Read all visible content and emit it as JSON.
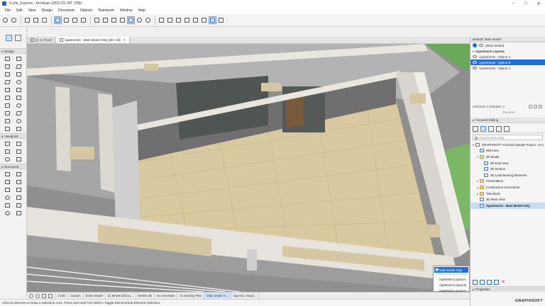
{
  "window": {
    "title": "5-Life_Express - Archicad v2023 D1 INT (780)",
    "minimize": "–",
    "maximize": "□",
    "close": "✕"
  },
  "menu": [
    "File",
    "Edit",
    "View",
    "Design",
    "Document",
    "Options",
    "Teamwork",
    "Window",
    "Help"
  ],
  "tabs": [
    {
      "label": "[2. 2. Floor]",
      "active": false
    },
    {
      "label": "Apartments - Main Model Only [3D / All]",
      "active": true
    }
  ],
  "toolbox": {
    "groups": [
      "Design",
      "Viewpoint",
      "Document"
    ]
  },
  "layouts_panel": {
    "default_label": "Default: Main Model",
    "main_model": "(Main Model)",
    "group": "Apartment Layouts",
    "options": [
      "Apartments - Option A",
      "Apartments - Option B",
      "Apartments - Option C"
    ],
    "selected_index": 1,
    "selected_info": "Selected: 0 Editable: 0",
    "rename_label": "Rename"
  },
  "focused_editing": "Focused Editing",
  "navigator": {
    "search_placeholder": "Search View Map",
    "tree": [
      {
        "label": "GRAPHISOFT Archicad Sample Project - 5-Li",
        "depth": 0,
        "kind": "project",
        "twisty": "▾"
      },
      {
        "label": "Welcome",
        "depth": 1,
        "kind": "view",
        "twisty": ""
      },
      {
        "label": "3D Model",
        "depth": 1,
        "kind": "folder",
        "twisty": "▾"
      },
      {
        "label": "3D East View",
        "depth": 2,
        "kind": "view",
        "twisty": ""
      },
      {
        "label": "3D Section",
        "depth": 2,
        "kind": "view",
        "twisty": ""
      },
      {
        "label": "3D Load Bearing Elements",
        "depth": 2,
        "kind": "view",
        "twisty": ""
      },
      {
        "label": "Presentation",
        "depth": 1,
        "kind": "folder",
        "twisty": "▸"
      },
      {
        "label": "Construction Documents",
        "depth": 1,
        "kind": "folder",
        "twisty": "▸"
      },
      {
        "label": "Title Block",
        "depth": 1,
        "kind": "folder",
        "twisty": "▸"
      },
      {
        "label": "3D West View",
        "depth": 1,
        "kind": "view",
        "twisty": ""
      },
      {
        "label": "Apartments - Main Model Only",
        "depth": 1,
        "kind": "view",
        "twisty": "",
        "selected": true
      }
    ]
  },
  "properties_label": "Properties",
  "brand": "GRAPHISOFT",
  "quick_options": [
    {
      "label": "1:100",
      "hl": false
    },
    {
      "label": "Custom",
      "hl": false
    },
    {
      "label": "Entire Model",
      "hl": false
    },
    {
      "label": "01 MAMA DOCU...",
      "hl": false
    },
    {
      "label": "MAMA 3D",
      "hl": false
    },
    {
      "label": "No Overrides",
      "hl": false
    },
    {
      "label": "01 Existing Plan",
      "hl": false
    },
    {
      "label": "Main Model O...",
      "hl": true
    },
    {
      "label": "OpenGL Visual...",
      "hl": false
    }
  ],
  "popup": {
    "checked": "Main Model Only",
    "items": [
      "Apartment Layout A",
      "Apartment Layout B",
      "Apartment Layout C"
    ]
  },
  "status": "Click an Element or Draw a Selection Area. Press and Hold Ctrl+Shift to Toggle Element/Sub-Element Selection.",
  "colors": {
    "accent": "#1f6fe0",
    "floor": "#d9c9a0",
    "wall_top": "#e9e6df",
    "slab": "#c9c9c9"
  }
}
